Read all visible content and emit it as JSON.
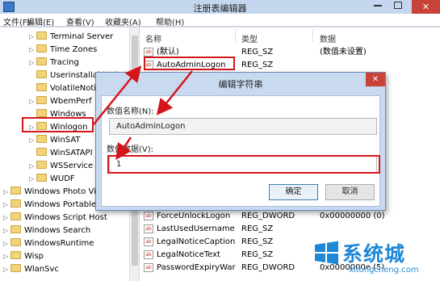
{
  "window": {
    "title": "注册表编辑器",
    "close_glyph": "✕"
  },
  "menu": [
    "文件(F)",
    "编辑(E)",
    "查看(V)",
    "收藏夹(A)",
    "帮助(H)"
  ],
  "tree": {
    "sub_items": [
      "Terminal Server",
      "Time Zones",
      "Tracing",
      "Userinstallable.d",
      "VolatileNotifi",
      "WbemPerf",
      "Windows",
      "Winlogon",
      "WinSAT",
      "WinSATAPI",
      "WSService",
      "WUDF"
    ],
    "top_items": [
      "Windows Photo Vie",
      "Windows Portable",
      "Windows Script Host",
      "Windows Search",
      "WindowsRuntime",
      "Wisp",
      "WlanSvc"
    ],
    "highlighted": "Winlogon"
  },
  "values_list": {
    "headers": {
      "name": "名称",
      "type": "类型",
      "data": "数据"
    },
    "top_rows": [
      {
        "icon": "ab",
        "name": "(默认)",
        "type": "REG_SZ",
        "data": "(数值未设置)"
      },
      {
        "icon": "ab",
        "name": "AutoAdminLogon",
        "type": "REG_SZ",
        "data": ""
      }
    ],
    "bottom_rows": [
      {
        "icon": "ab",
        "name": "ForceUnlockLogon",
        "type": "REG_DWORD",
        "data": "0x00000000 (0)"
      },
      {
        "icon": "ab",
        "name": "LastUsedUsername",
        "type": "REG_SZ",
        "data": ""
      },
      {
        "icon": "ab",
        "name": "LegalNoticeCaption",
        "type": "REG_SZ",
        "data": ""
      },
      {
        "icon": "ab",
        "name": "LegalNoticeText",
        "type": "REG_SZ",
        "data": ""
      },
      {
        "icon": "ab",
        "name": "PasswordExpiryWar",
        "type": "REG_DWORD",
        "data": "0x0000000e (5)"
      }
    ]
  },
  "dialog": {
    "title": "编辑字符串",
    "close_glyph": "✕",
    "name_label": "数值名称(N):",
    "name_value": "AutoAdminLogon",
    "data_label": "数值数据(V):",
    "data_value": "1",
    "ok_label": "确定",
    "cancel_label": "取消"
  },
  "watermark": {
    "brand": "系统城",
    "url": "xitongcheng.com"
  },
  "colors": {
    "highlight_red": "#d4161c",
    "window_blue": "#c9daf0",
    "watermark_blue": "#1e88d8"
  }
}
